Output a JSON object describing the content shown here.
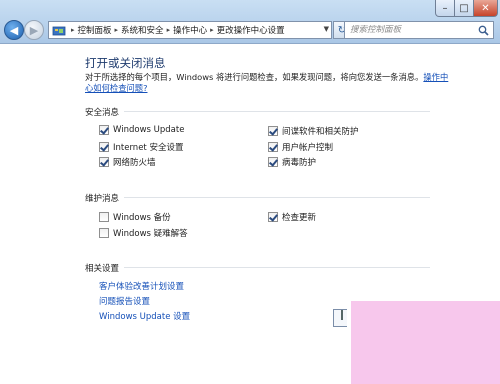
{
  "window": {
    "controls": {
      "minimize": "–",
      "maximize": "□",
      "close": "✕"
    }
  },
  "address": {
    "crumbs": [
      "控制面板",
      "系统和安全",
      "操作中心",
      "更改操作中心设置"
    ]
  },
  "search": {
    "placeholder": "搜索控制面板"
  },
  "main": {
    "title": "打开或关闭消息",
    "description": "对于所选择的每个项目，Windows 将进行问题检查，如果发现问题，将向您发送一条消息。",
    "description_link": "操作中心如何检查问题?"
  },
  "security": {
    "heading": "安全消息",
    "items": [
      {
        "label": "Windows Update",
        "checked": true
      },
      {
        "label": "Internet 安全设置",
        "checked": true
      },
      {
        "label": "网络防火墙",
        "checked": true
      },
      {
        "label": "间谍软件和相关防护",
        "checked": true
      },
      {
        "label": "用户帐户控制",
        "checked": true
      },
      {
        "label": "病毒防护",
        "checked": true
      }
    ]
  },
  "maintenance": {
    "heading": "维护消息",
    "items": [
      {
        "label": "Windows 备份",
        "checked": false
      },
      {
        "label": "Windows 疑难解答",
        "checked": false
      },
      {
        "label": "检查更新",
        "checked": true
      }
    ]
  },
  "related": {
    "heading": "相关设置",
    "links": [
      "客户体验改善计划设置",
      "问题报告设置",
      "Windows Update 设置"
    ]
  },
  "colors": {
    "link": "#1550b8",
    "title": "#1e3b6e",
    "overlay": "#f7c7ec"
  }
}
